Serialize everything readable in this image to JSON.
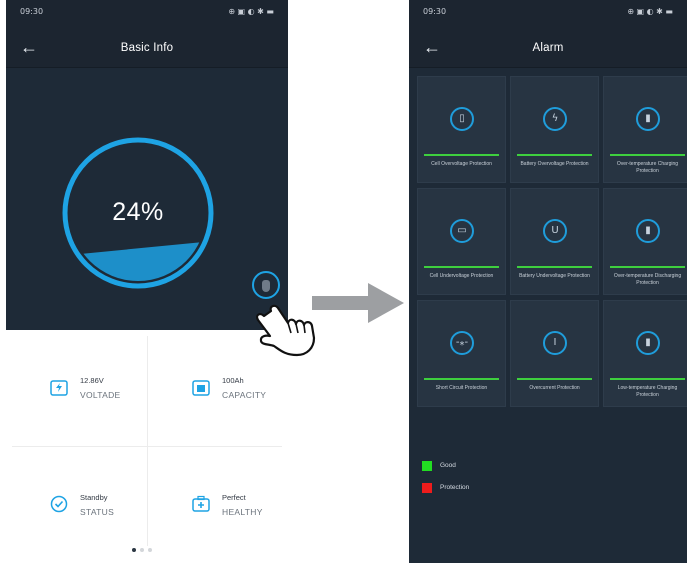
{
  "left_screen": {
    "status_time": "09:30",
    "status_icons": "⊕ ▣ ◐ ✱ ▬",
    "title": "Basic Info",
    "battery_percent": "24%",
    "battery_level": 0.24,
    "info": [
      {
        "value": "12.86V",
        "label": "VOLTADE"
      },
      {
        "value": "100Ah",
        "label": "CAPACITY"
      },
      {
        "value": "Standby",
        "label": "STATUS"
      },
      {
        "value": "Perfect",
        "label": "HEALTHY"
      }
    ],
    "page_indicator": {
      "pages": 3,
      "current": 1
    }
  },
  "right_screen": {
    "status_time": "09:30",
    "status_icons": "⊕ ▣ ◐ ✱ ▬",
    "title": "Alarm",
    "alarms": [
      {
        "label": "Cell Overvoltage Protection",
        "icon": "battery-icon",
        "glyph": "▯",
        "status": "good"
      },
      {
        "label": "Battery Overvoltage Protection",
        "icon": "lightning-icon",
        "glyph": "ϟ",
        "status": "good"
      },
      {
        "label": "Over-temperature Charging Protection",
        "icon": "thermometer-icon",
        "glyph": "▮",
        "status": "good"
      },
      {
        "label": "Cell Undervoltage Protection",
        "icon": "battery-low-icon",
        "glyph": "▭",
        "status": "good"
      },
      {
        "label": "Battery Undervoltage Protection",
        "icon": "voltage-icon",
        "glyph": "U",
        "status": "good"
      },
      {
        "label": "Over-temperature Discharging Protection",
        "icon": "thermometer-icon",
        "glyph": "▮",
        "status": "good"
      },
      {
        "label": "Short Circuit Protection",
        "icon": "short-circuit-icon",
        "glyph": "-⁎-",
        "status": "good"
      },
      {
        "label": "Overcurrent Protection",
        "icon": "current-icon",
        "glyph": "I",
        "status": "good"
      },
      {
        "label": "Low-temperature Charging Protection",
        "icon": "thermometer-icon",
        "glyph": "▮",
        "status": "good"
      }
    ],
    "legend": [
      {
        "label": "Good",
        "color": "#22dd22"
      },
      {
        "label": "Protection",
        "color": "#ee1c1c"
      }
    ]
  },
  "colors": {
    "accent_blue": "#1ea3e4",
    "background_dark": "#1e2a37",
    "good_green": "#3ecf3e"
  }
}
